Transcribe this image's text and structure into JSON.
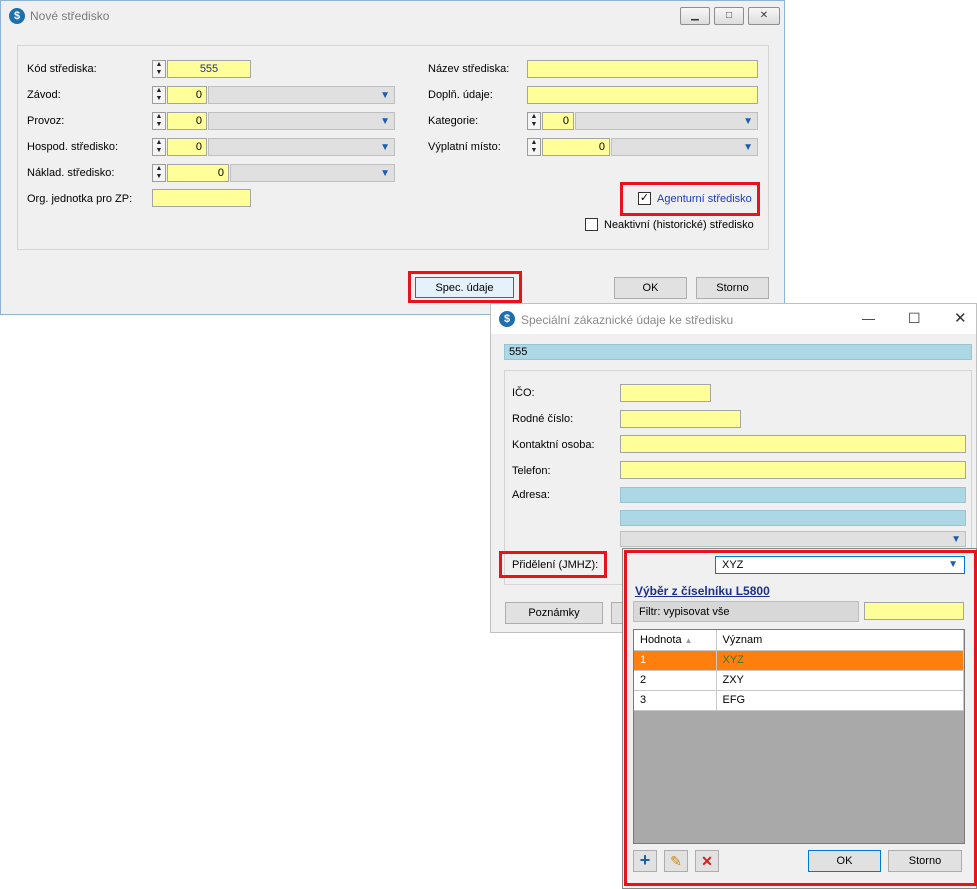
{
  "win1": {
    "title": "Nové středisko",
    "fields": {
      "kod_label": "Kód střediska:",
      "kod_value": "555",
      "zavod_label": "Závod:",
      "zavod_value": "0",
      "provoz_label": "Provoz:",
      "provoz_value": "0",
      "hospod_label": "Hospod. středisko:",
      "hospod_value": "0",
      "naklad_label": "Náklad. středisko:",
      "naklad_value": "0",
      "org_label": "Org. jednotka pro ZP:",
      "org_value": "",
      "nazev_label": "Název střediska:",
      "nazev_value": "",
      "dopln_label": "Doplň. údaje:",
      "dopln_value": "",
      "kategorie_label": "Kategorie:",
      "kategorie_value": "0",
      "vyplatni_label": "Výplatní místo:",
      "vyplatni_value": "0"
    },
    "agenturni_label": "Agenturní středisko",
    "agenturni_checked": true,
    "neaktivni_label": "Neaktivní (historické) středisko",
    "neaktivni_checked": false,
    "spec_button": "Spec. údaje",
    "ok_button": "OK",
    "storno_button": "Storno"
  },
  "win2": {
    "title": "Speciální zákaznické údaje ke středisku",
    "header_value": "555",
    "ico_label": "IČO:",
    "rodne_label": "Rodné číslo:",
    "kontakt_label": "Kontaktní osoba:",
    "telefon_label": "Telefon:",
    "adresa_label": "Adresa:",
    "prideleni_label": "Přidělení (JMHZ):",
    "poznamky_button": "Poznámky"
  },
  "dropdown": {
    "selected": "XYZ",
    "heading": "Výběr z číselníku L5800",
    "filter_label": "Filtr: vypisovat vše",
    "col_hodnota": "Hodnota",
    "col_vyznam": "Význam",
    "rows": [
      {
        "hodnota": "1",
        "vyznam": "XYZ"
      },
      {
        "hodnota": "2",
        "vyznam": "ZXY"
      },
      {
        "hodnota": "3",
        "vyznam": "EFG"
      }
    ],
    "ok_button": "OK",
    "storno_button": "Storno"
  },
  "colors": {
    "highlight": "#e5141b",
    "selected_row": "#ff7f0e",
    "yellow_field": "#ffff99",
    "blue_field": "#acd8e6"
  },
  "icons": [
    "app-icon",
    "minimize-icon",
    "maximize-icon",
    "close-icon",
    "plus-icon",
    "pencil-icon",
    "delete-icon",
    "chevron-down-icon",
    "sort-icon"
  ]
}
